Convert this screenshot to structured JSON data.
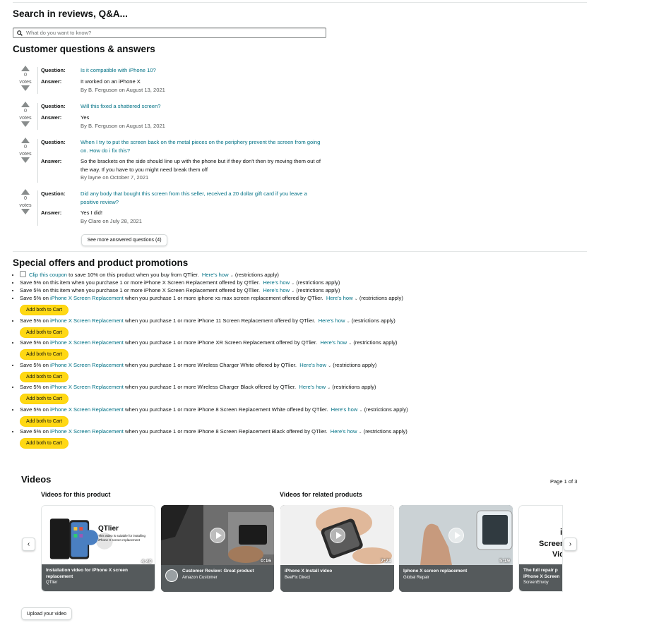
{
  "search": {
    "heading": "Search in reviews, Q&A...",
    "placeholder": "What do you want to know?"
  },
  "qa": {
    "heading": "Customer questions & answers",
    "question_label": "Question:",
    "answer_label": "Answer:",
    "votes_label": "votes",
    "items": [
      {
        "votes": "0",
        "question": "Is it compatible with iPhone 10?",
        "answer": "It worked on an iPhone X",
        "by": "By B. Ferguson on August 13, 2021"
      },
      {
        "votes": "0",
        "question": "Will this fixed a shattered screen?",
        "answer": "Yes",
        "by": "By B. Ferguson on August 13, 2021"
      },
      {
        "votes": "0",
        "question": "When I try to put the screen back on the metal pieces on the periphery prevent the screen from going on. How do i fix this?",
        "answer": "So the brackets on the side should line up with the phone but if they don't then try moving them out of the way. If you have to you might need break them off",
        "by": "By layne on October 7, 2021"
      },
      {
        "votes": "0",
        "question": "Did any body that bought this screen from this seller, received a 20 dollar gift card if you leave a positive review?",
        "answer": "Yes I did!",
        "by": "By Clare on July 28, 2021"
      }
    ],
    "see_more": "See more answered questions (4)"
  },
  "promos": {
    "heading": "Special offers and product promotions",
    "heres_how": "Here's how",
    "restrictions": "(restrictions apply)",
    "add_both": "Add both to Cart",
    "items": [
      {
        "checkbox": true,
        "link": "Clip this coupon",
        "text": " to save 10% on this product when you buy from QTlier.",
        "cart": false
      },
      {
        "pre": "Save 5% on this item when you purchase 1 or more iPhone X Screen Replacement offered by QTlier.",
        "cart": false
      },
      {
        "pre": "Save 5% on this item when you purchase 1 or more iPhone X Screen Replacement offered by QTlier.",
        "cart": false
      },
      {
        "pre": "Save 5% on ",
        "link": "iPhone X Screen Replacement",
        "text": " when you purchase 1 or more iphone xs max screen replacement offered by QTlier.",
        "cart": true
      },
      {
        "pre": "Save 5% on ",
        "link": "iPhone X Screen Replacement",
        "text": " when you purchase 1 or more iPhone 11 Screen Replacement offered by QTlier.",
        "cart": true
      },
      {
        "pre": "Save 5% on ",
        "link": "iPhone X Screen Replacement",
        "text": " when you purchase 1 or more iPhone XR Screen Replacement offered by QTlier.",
        "cart": true
      },
      {
        "pre": "Save 5% on ",
        "link": "iPhone X Screen Replacement",
        "text": " when you purchase 1 or more Wireless Charger White offered by QTlier.",
        "cart": true
      },
      {
        "pre": "Save 5% on ",
        "link": "iPhone X Screen Replacement",
        "text": " when you purchase 1 or more Wireless Charger Black offered by QTlier.",
        "cart": true
      },
      {
        "pre": "Save 5% on ",
        "link": "iPhone X Screen Replacement",
        "text": " when you purchase 1 or more iPhone 8 Screen Replacement White offered by QTlier.",
        "cart": true
      },
      {
        "pre": "Save 5% on ",
        "link": "iPhone X Screen Replacement",
        "text": " when you purchase 1 or more iPhone 8 Screen Replacement Black offered by QTlier.",
        "cart": true
      }
    ]
  },
  "videos": {
    "heading": "Videos",
    "page": "Page 1 of 3",
    "this_product": "Videos for this product",
    "related": "Videos for related products",
    "upload": "Upload your video",
    "items": [
      {
        "title": "Installation video for iPhone X screen replacement",
        "by": "QTlier",
        "duration": "4:48",
        "thumb_brand": "QTlier",
        "thumb_text": "This video is suitable for installing iPhone X screen replacement"
      },
      {
        "title": "Customer Review: Great product",
        "by": "Amazon Customer",
        "duration": "0:16"
      },
      {
        "title": "iPhone X Install video",
        "by": "BeeFix Direct",
        "duration": "7:21"
      },
      {
        "title": "Iphone X screen replacement",
        "by": "Global Repair",
        "duration": "5:19"
      },
      {
        "title": "The full repair p",
        "title2": "iPhone X Screen",
        "by": "ScreenEnvoy",
        "thumb_text": "Screen",
        "thumb_text2": "Vid"
      }
    ]
  },
  "colors": {
    "link": "#007185",
    "cart_button": "#ffd814",
    "text": "#0f1111"
  }
}
